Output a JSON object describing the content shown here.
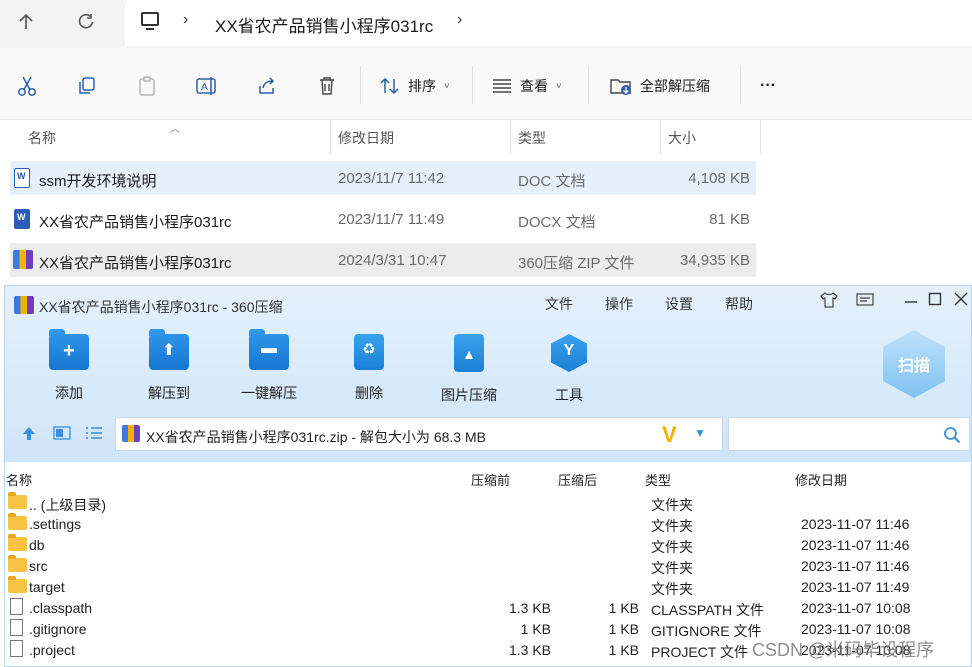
{
  "explorer": {
    "address": {
      "path": "XX省农产品销售小程序031rc"
    },
    "toolbar": {
      "sort_label": "排序",
      "view_label": "查看",
      "extract_all_label": "全部解压缩",
      "more_label": "···"
    },
    "columns": {
      "name": "名称",
      "modified": "修改日期",
      "type": "类型",
      "size": "大小"
    },
    "files": [
      {
        "name": "ssm开发环境说明",
        "modified": "2023/11/7 11:42",
        "type": "DOC 文档",
        "size": "4,108 KB",
        "icon": "word-doc-icon"
      },
      {
        "name": "XX省农产品销售小程序031rc",
        "modified": "2023/11/7 11:49",
        "type": "DOCX 文档",
        "size": "81 KB",
        "icon": "word-docx-icon"
      },
      {
        "name": "XX省农产品销售小程序031rc",
        "modified": "2024/3/31 10:47",
        "type": "360压缩 ZIP 文件",
        "size": "34,935 KB",
        "icon": "zip-icon"
      }
    ]
  },
  "zip_window": {
    "title": "XX省农产品销售小程序031rc - 360压缩",
    "menu": [
      "文件",
      "操作",
      "设置",
      "帮助"
    ],
    "tools": [
      {
        "label": "添加",
        "icon": "add-folder-icon"
      },
      {
        "label": "解压到",
        "icon": "extract-to-icon"
      },
      {
        "label": "一键解压",
        "icon": "one-click-extract-icon"
      },
      {
        "label": "删除",
        "icon": "recycle-bin-icon"
      },
      {
        "label": "图片压缩",
        "icon": "image-compress-icon"
      },
      {
        "label": "工具",
        "icon": "tools-icon"
      }
    ],
    "scan_label": "扫描",
    "path_text": "XX省农产品销售小程序031rc.zip - 解包大小为 68.3 MB",
    "columns": {
      "name": "名称",
      "before": "压缩前",
      "after": "压缩后",
      "type": "类型",
      "modified": "修改日期"
    },
    "entries": [
      {
        "name": ".. (上级目录)",
        "before": "",
        "after": "",
        "type": "文件夹",
        "modified": "",
        "kind": "folder"
      },
      {
        "name": ".settings",
        "before": "",
        "after": "",
        "type": "文件夹",
        "modified": "2023-11-07 11:46",
        "kind": "folder"
      },
      {
        "name": "db",
        "before": "",
        "after": "",
        "type": "文件夹",
        "modified": "2023-11-07 11:46",
        "kind": "folder"
      },
      {
        "name": "src",
        "before": "",
        "after": "",
        "type": "文件夹",
        "modified": "2023-11-07 11:46",
        "kind": "folder"
      },
      {
        "name": "target",
        "before": "",
        "after": "",
        "type": "文件夹",
        "modified": "2023-11-07 11:49",
        "kind": "folder"
      },
      {
        "name": ".classpath",
        "before": "1.3 KB",
        "after": "1 KB",
        "type": "CLASSPATH 文件",
        "modified": "2023-11-07 10:08",
        "kind": "file"
      },
      {
        "name": ".gitignore",
        "before": "1 KB",
        "after": "1 KB",
        "type": "GITIGNORE 文件",
        "modified": "2023-11-07 10:08",
        "kind": "file"
      },
      {
        "name": ".project",
        "before": "1.3 KB",
        "after": "1 KB",
        "type": "PROJECT 文件",
        "modified": "2023-11-07 10:08",
        "kind": "file"
      }
    ]
  },
  "watermark": "CSDN @米码毕设程序"
}
